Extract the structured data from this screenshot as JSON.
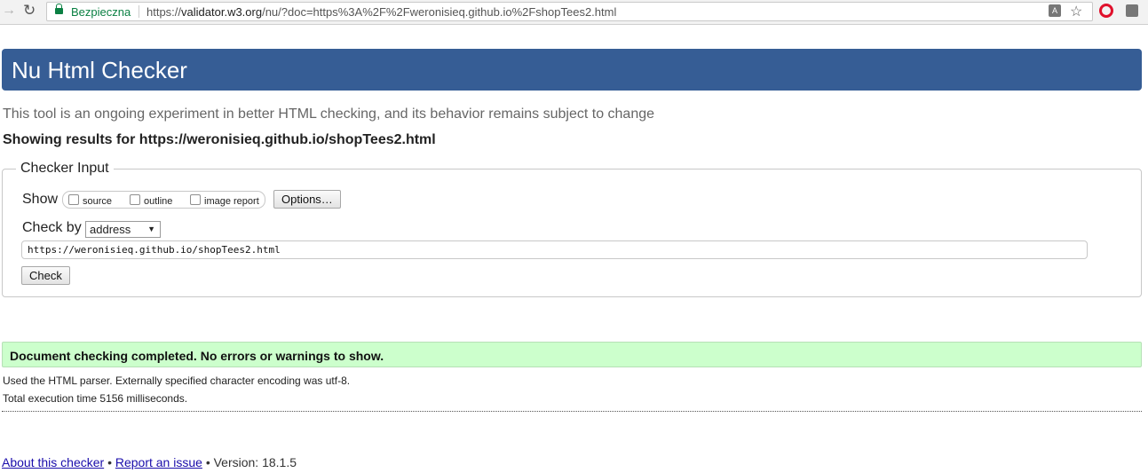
{
  "browser": {
    "secure_label": "Bezpieczna",
    "url_prefix": "https://",
    "url_host": "validator.w3.org",
    "url_path": "/nu/?doc=https%3A%2F%2Fweronisieq.github.io%2FshopTees2.html",
    "icons": [
      "forward-icon",
      "reload-icon",
      "lock-icon",
      "translate-icon",
      "star-icon",
      "opera-icon",
      "extension-icon"
    ]
  },
  "header": {
    "title": "Nu Html Checker"
  },
  "tagline": "This tool is an ongoing experiment in better HTML checking, and its behavior remains subject to change",
  "results_title": "Showing results for https://weronisieq.github.io/shopTees2.html",
  "checker_input": {
    "legend": "Checker Input",
    "show_label": "Show",
    "options": [
      {
        "label": "source",
        "checked": false
      },
      {
        "label": "outline",
        "checked": false
      },
      {
        "label": "image report",
        "checked": false
      }
    ],
    "options_button": "Options…",
    "check_by_label": "Check by",
    "check_by_value": "address",
    "address_value": "https://weronisieq.github.io/shopTees2.html",
    "check_button": "Check"
  },
  "result": {
    "message": "Document checking completed. No errors or warnings to show.",
    "parser_info": "Used the HTML parser. Externally specified character encoding was utf-8.",
    "time_info": "Total execution time 5156 milliseconds."
  },
  "footer": {
    "about_link": "About this checker",
    "bullet": "•",
    "report_link": "Report an issue",
    "version": "• Version: 18.1.5"
  },
  "colors": {
    "banner": "#365d95",
    "success_bg": "#ccffcc",
    "secure_green": "#0b8043"
  }
}
